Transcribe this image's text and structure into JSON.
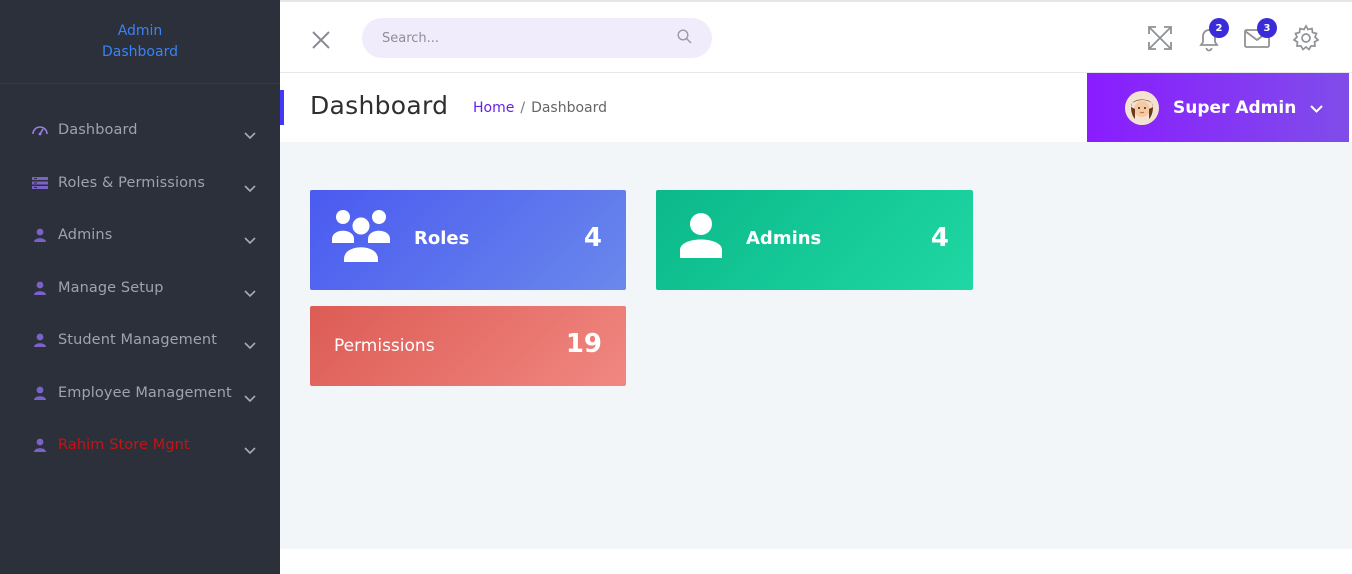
{
  "sidebar": {
    "brand_line1": "Admin",
    "brand_line2": "Dashboard",
    "items": [
      {
        "label": "Dashboard",
        "icon": "dashboard-icon"
      },
      {
        "label": "Roles & Permissions",
        "icon": "list-icon"
      },
      {
        "label": "Admins",
        "icon": "user-icon"
      },
      {
        "label": "Manage Setup",
        "icon": "user-icon"
      },
      {
        "label": "Student Management",
        "icon": "user-icon"
      },
      {
        "label": "Employee Management",
        "icon": "user-icon"
      },
      {
        "label": "Rahim Store Mgnt",
        "icon": "user-icon"
      }
    ]
  },
  "topbar": {
    "search_placeholder": "Search...",
    "notifications_count": "2",
    "messages_count": "3"
  },
  "header": {
    "title": "Dashboard",
    "breadcrumb_home": "Home",
    "breadcrumb_sep": "/",
    "breadcrumb_current": "Dashboard",
    "user_name": "Super Admin"
  },
  "cards": {
    "roles": {
      "label": "Roles",
      "value": "4"
    },
    "admins": {
      "label": "Admins",
      "value": "4"
    },
    "permissions": {
      "label": "Permissions",
      "value": "19"
    }
  },
  "colors": {
    "sidebar_bg": "#2b303a",
    "brand_text": "#3b82f6",
    "accent_purple": "#8a1cff",
    "roles_card": "#4a5af0",
    "admins_card": "#0bb889",
    "permissions_card": "#dc5c55",
    "danger_text": "#c41414"
  }
}
